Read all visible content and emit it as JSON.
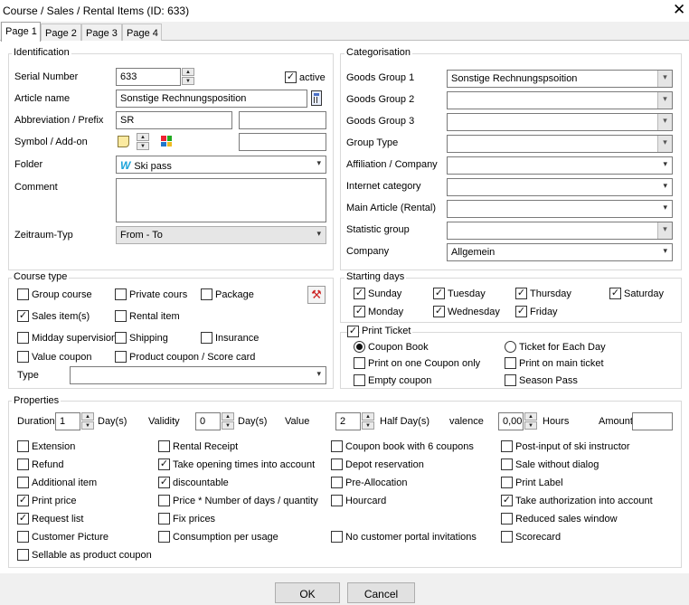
{
  "window": {
    "title": "Course / Sales / Rental Items (ID: 633)"
  },
  "tabs": [
    "Page 1",
    "Page 2",
    "Page 3",
    "Page 4"
  ],
  "identification": {
    "legend": "Identification",
    "serial_label": "Serial Number",
    "serial_value": "633",
    "active_label": "active",
    "article_label": "Article name",
    "article_value": "Sonstige Rechnungsposition",
    "abbr_label": "Abbreviation / Prefix",
    "abbr_value": "SR",
    "symbol_label": "Symbol / Add-on",
    "folder_label": "Folder",
    "folder_icon_text": "W",
    "folder_value": "Ski pass",
    "comment_label": "Comment",
    "zeitraum_label": "Zeitraum-Typ",
    "zeitraum_value": "From - To"
  },
  "categorisation": {
    "legend": "Categorisation",
    "rows": [
      {
        "label": "Goods Group 1",
        "value": "Sonstige Rechnungspsoition"
      },
      {
        "label": "Goods Group 2",
        "value": ""
      },
      {
        "label": "Goods Group 3",
        "value": ""
      },
      {
        "label": "Group Type",
        "value": ""
      },
      {
        "label": "Affiliation / Company",
        "value": ""
      },
      {
        "label": "Internet category",
        "value": ""
      },
      {
        "label": "Main Article (Rental)",
        "value": ""
      },
      {
        "label": "Statistic group",
        "value": ""
      },
      {
        "label": "Company",
        "value": "Allgemein"
      }
    ]
  },
  "course_type": {
    "legend": "Course type",
    "items": {
      "group_course": "Group course",
      "private_cours": "Private cours",
      "package": "Package",
      "sales_items": "Sales item(s)",
      "rental_item": "Rental item",
      "midday": "Midday supervision",
      "shipping": "Shipping",
      "insurance": "Insurance",
      "value_coupon": "Value coupon",
      "product_coupon": "Product coupon / Score card"
    },
    "type_label": "Type",
    "type_value": ""
  },
  "starting_days": {
    "legend": "Starting days",
    "days": {
      "sunday": "Sunday",
      "tuesday": "Tuesday",
      "thursday": "Thursday",
      "saturday": "Saturday",
      "monday": "Monday",
      "wednesday": "Wednesday",
      "friday": "Friday"
    }
  },
  "print_ticket": {
    "legend": "Print Ticket",
    "coupon_book": "Coupon Book",
    "ticket_each_day": "Ticket for Each Day",
    "print_one_coupon": "Print on one Coupon only",
    "print_main_ticket": "Print on main ticket",
    "empty_coupon": "Empty coupon",
    "season_pass": "Season Pass"
  },
  "properties": {
    "legend": "Properties",
    "duration_label": "Duration",
    "duration_value": "1",
    "duration_unit": "Day(s)",
    "validity_label": "Validity",
    "validity_value": "0",
    "validity_unit": "Day(s)",
    "value_label": "Value",
    "value_value": "2",
    "value_unit": "Half Day(s)",
    "valence_label": "valence",
    "valence_value": "0,00",
    "valence_unit": "Hours",
    "amount_label": "Amount",
    "amount_value": "",
    "col1": [
      "Extension",
      "Refund",
      "Additional item",
      "Print price",
      "Request list",
      "Customer Picture",
      "Sellable as product coupon"
    ],
    "col2": [
      "Rental Receipt",
      "Take opening times into account",
      "discountable",
      "Price * Number of days / quantity",
      "Fix prices",
      "Consumption per usage"
    ],
    "col3": [
      "Coupon book with 6 coupons",
      "Depot reservation",
      "Pre-Allocation",
      "Hourcard",
      "",
      "No customer portal invitations"
    ],
    "col4": [
      "Post-input of ski instructor",
      "Sale without dialog",
      "Print Label",
      "Take authorization into account",
      "Reduced sales window",
      "Scorecard"
    ]
  },
  "buttons": {
    "ok": "OK",
    "cancel": "Cancel"
  },
  "icons": {
    "close": "close-icon",
    "calculator": "calculator-icon",
    "note": "note-icon",
    "grid": "color-grid-icon",
    "folder": "folder-w-icon",
    "tool": "course-type-tool-icon"
  }
}
